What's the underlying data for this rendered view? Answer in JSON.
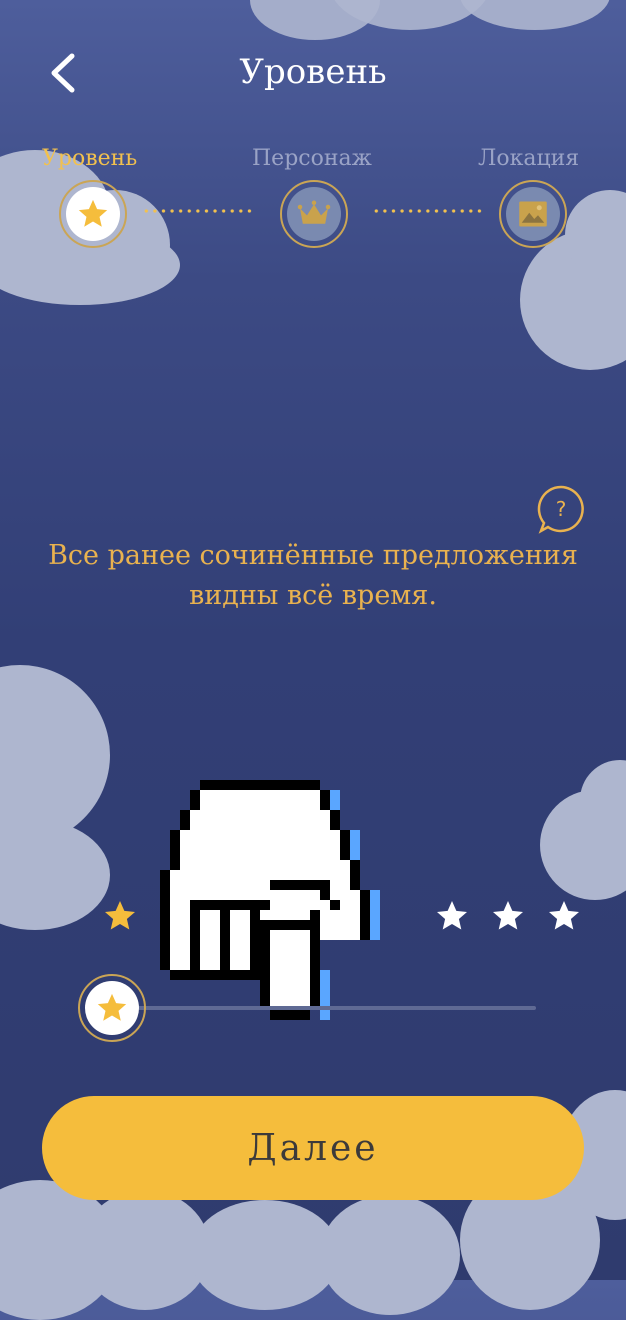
{
  "header": {
    "title": "Уровень"
  },
  "steps": [
    {
      "label": "Уровень",
      "icon": "star-icon",
      "active": true
    },
    {
      "label": "Персонаж",
      "icon": "crown-icon",
      "active": false
    },
    {
      "label": "Локация",
      "icon": "image-icon",
      "active": false
    }
  ],
  "description": "Все ранее сочинённые предложения видны всё время.",
  "difficulty": {
    "min_stars": 1,
    "max_stars": 3,
    "selected_stars": 1
  },
  "next_label": "Далее",
  "colors": {
    "accent": "#f5bd3c",
    "gold_text": "#e9b24f",
    "background": "#323f76"
  }
}
